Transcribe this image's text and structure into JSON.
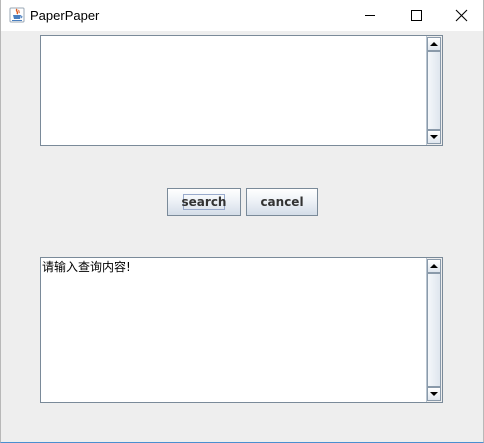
{
  "window": {
    "title": "PaperPaper",
    "icon": "java-cup-icon",
    "controls": [
      "minimize-icon",
      "maximize-icon",
      "close-icon"
    ]
  },
  "top_text_area": {
    "value": ""
  },
  "buttons": {
    "search_label": "search",
    "cancel_label": "cancel"
  },
  "bottom_text_area": {
    "value": "请输入查询内容!"
  },
  "colors": {
    "background": "#eeeeee",
    "border": "#7a8a99",
    "button_text": "#333333",
    "title_bar": "#ffffff"
  }
}
